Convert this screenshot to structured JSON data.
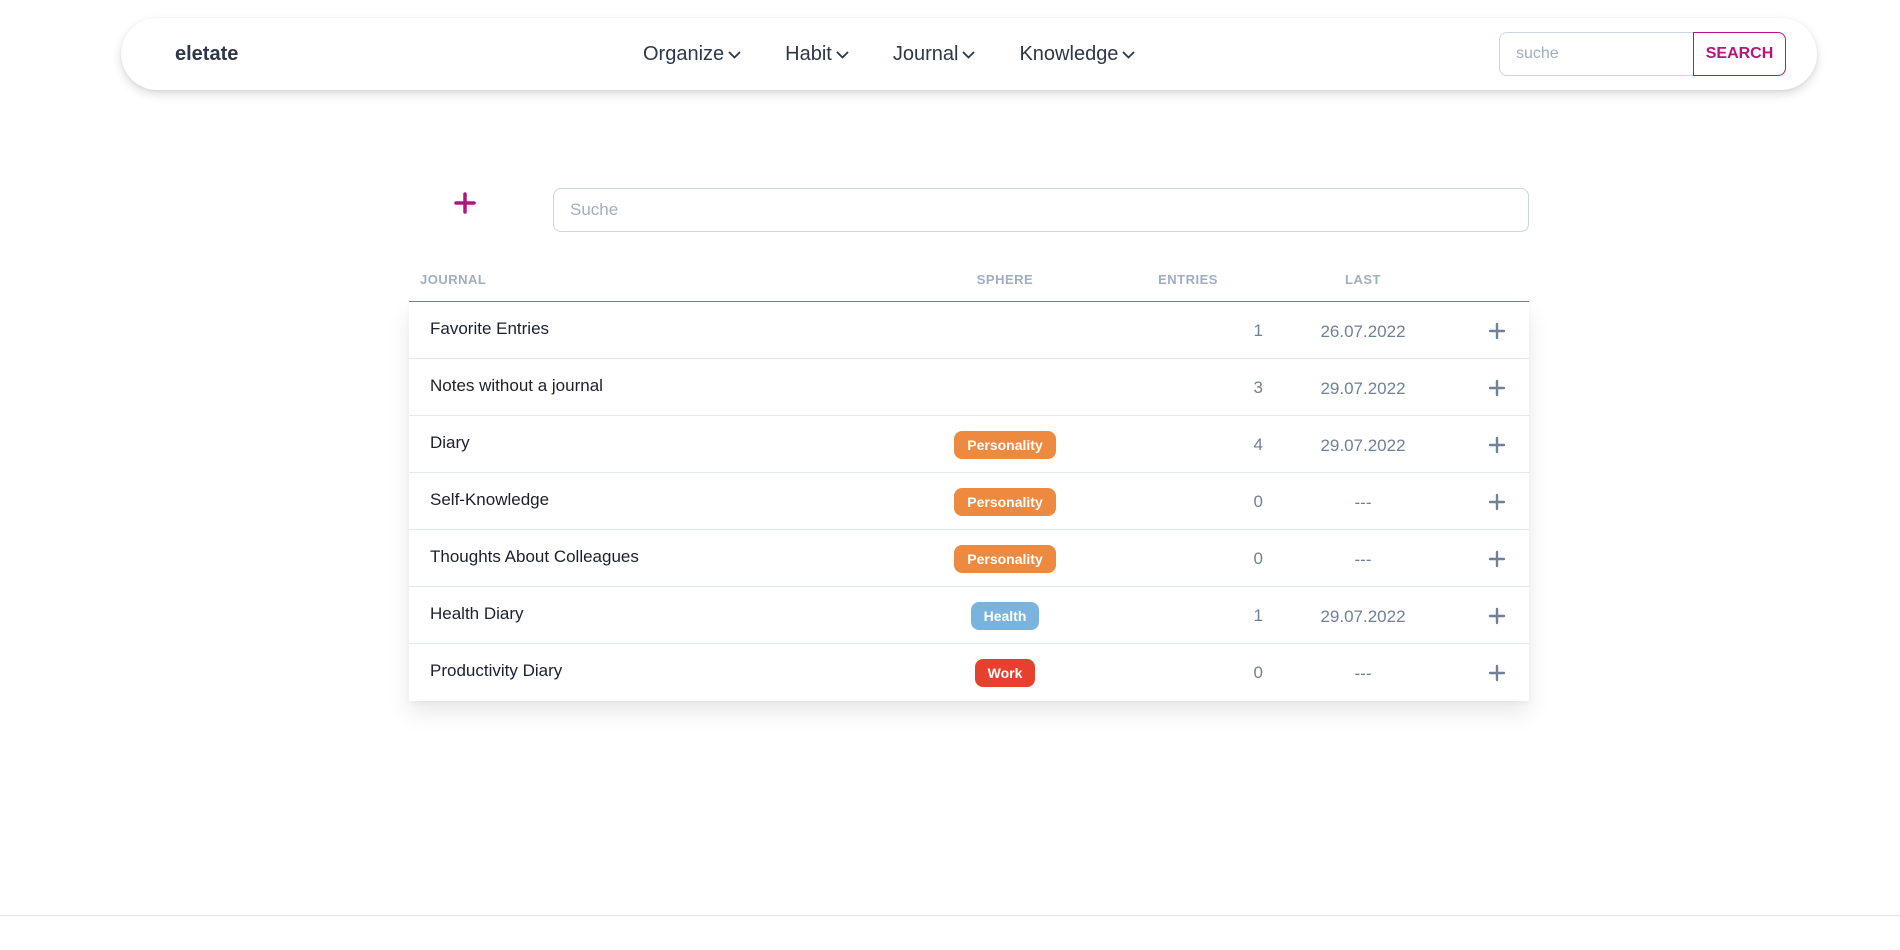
{
  "navbar": {
    "brand": "eletate",
    "menu": [
      {
        "label": "Organize",
        "icon": "chevron-down-icon"
      },
      {
        "label": "Habit",
        "icon": "chevron-down-icon"
      },
      {
        "label": "Journal",
        "icon": "chevron-down-icon"
      },
      {
        "label": "Knowledge",
        "icon": "chevron-down-icon"
      }
    ],
    "search": {
      "placeholder": "suche",
      "button_label": "SEARCH"
    }
  },
  "toolbar": {
    "add_icon": "plus-icon",
    "filter_placeholder": "Suche"
  },
  "table": {
    "headers": {
      "journal": "JOURNAL",
      "sphere": "SPHERE",
      "entries": "ENTRIES",
      "last": "LAST"
    },
    "rows": [
      {
        "name": "Favorite Entries",
        "sphere": "",
        "entries": "1",
        "last": "26.07.2022"
      },
      {
        "name": "Notes without a journal",
        "sphere": "",
        "entries": "3",
        "last": "29.07.2022"
      },
      {
        "name": "Diary",
        "sphere": "Personality",
        "entries": "4",
        "last": "29.07.2022"
      },
      {
        "name": "Self-Knowledge",
        "sphere": "Personality",
        "entries": "0",
        "last": "---"
      },
      {
        "name": "Thoughts About Colleagues",
        "sphere": "Personality",
        "entries": "0",
        "last": "---"
      },
      {
        "name": "Health Diary",
        "sphere": "Health",
        "entries": "1",
        "last": "29.07.2022"
      },
      {
        "name": "Productivity Diary",
        "sphere": "Work",
        "entries": "0",
        "last": "---"
      }
    ]
  },
  "colors": {
    "accent": "#b5157b",
    "sphere_personality": "#ed8a3f",
    "sphere_health": "#7ab4dc",
    "sphere_work": "#e8402e"
  }
}
